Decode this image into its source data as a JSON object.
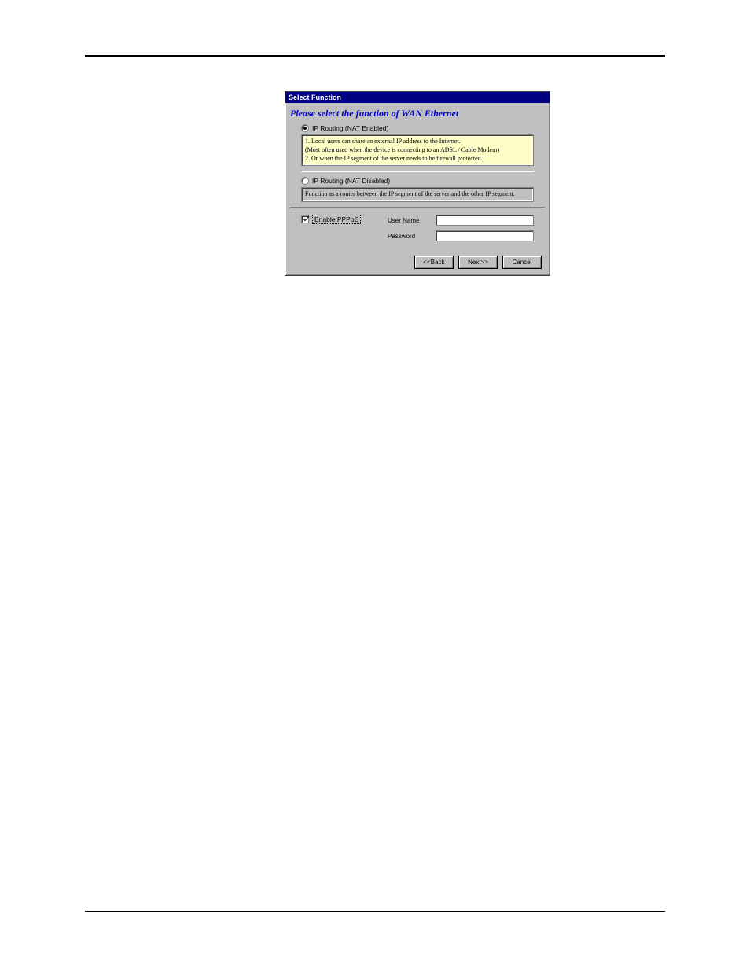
{
  "dialog": {
    "title": "Select Function",
    "heading": "Please select the function of WAN Ethernet",
    "option1": {
      "label": "IP Routing (NAT Enabled)",
      "desc_line1": "1. Local users can share an external IP address to the Internet.",
      "desc_line2": "(Most often used when the device is connecting to an ADSL / Cable Modem)",
      "desc_line3": "2. Or when the IP segment of the server needs to be firewall protected."
    },
    "option2": {
      "label": "IP Routing (NAT Disabled)",
      "desc": "Function as a router between the IP segment of the server and the other IP segment."
    },
    "pppoe": {
      "checkbox_label": "Enable PPPoE",
      "username_label": "User Name",
      "password_label": "Password",
      "username_value": "",
      "password_value": ""
    },
    "buttons": {
      "back": "<<Back",
      "next": "Next>>",
      "cancel": "Cancel"
    }
  }
}
